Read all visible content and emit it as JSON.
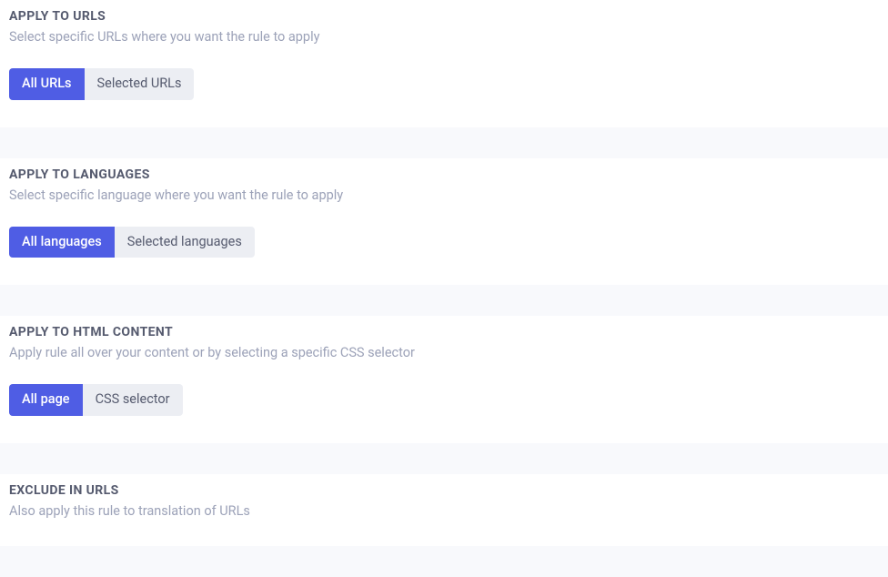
{
  "sections": {
    "apply_urls": {
      "heading": "APPLY TO URLS",
      "subtext": "Select specific URLs where you want the rule to apply",
      "option_a": "All URLs",
      "option_b": "Selected URLs"
    },
    "apply_languages": {
      "heading": "APPLY TO LANGUAGES",
      "subtext": "Select specific language where you want the rule to apply",
      "option_a": "All languages",
      "option_b": "Selected languages"
    },
    "apply_html": {
      "heading": "APPLY TO HTML CONTENT",
      "subtext": "Apply rule all over your content or by selecting a specific CSS selector",
      "option_a": "All page",
      "option_b": "CSS selector"
    },
    "exclude_urls": {
      "heading": "EXCLUDE IN URLS",
      "subtext": "Also apply this rule to translation of URLs"
    }
  }
}
